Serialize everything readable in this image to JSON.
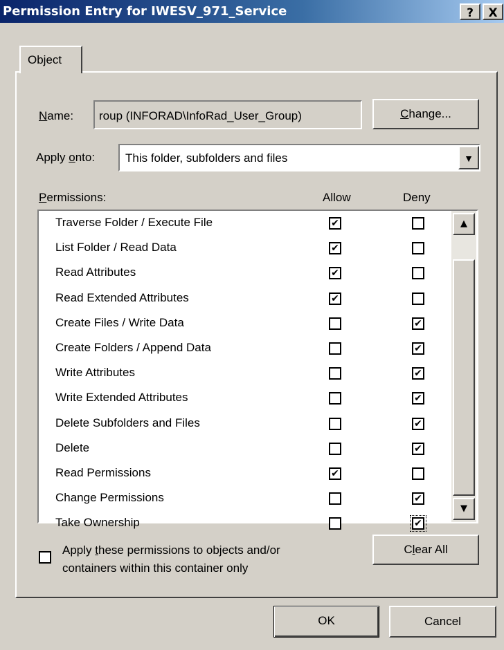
{
  "window": {
    "title": "Permission Entry for IWESV_971_Service",
    "help_btn": "?",
    "close_btn": "X"
  },
  "tab": {
    "label": "Object"
  },
  "name": {
    "label_u": "N",
    "label_rest": "ame:",
    "value": "roup (INFORAD\\InfoRad_User_Group)",
    "change_u": "C",
    "change_rest": "hange..."
  },
  "apply_onto": {
    "label_pre": "Apply ",
    "label_u": "o",
    "label_rest": "nto:",
    "value": "This folder, subfolders and files"
  },
  "permissions": {
    "label_u": "P",
    "label_rest": "ermissions:",
    "allow_header": "Allow",
    "deny_header": "Deny",
    "rows": [
      {
        "name": "Traverse Folder / Execute File",
        "allow": true,
        "deny": false
      },
      {
        "name": "List Folder / Read Data",
        "allow": true,
        "deny": false
      },
      {
        "name": "Read Attributes",
        "allow": true,
        "deny": false
      },
      {
        "name": "Read Extended Attributes",
        "allow": true,
        "deny": false
      },
      {
        "name": "Create Files / Write Data",
        "allow": false,
        "deny": true
      },
      {
        "name": "Create Folders / Append Data",
        "allow": false,
        "deny": true
      },
      {
        "name": "Write Attributes",
        "allow": false,
        "deny": true
      },
      {
        "name": "Write Extended Attributes",
        "allow": false,
        "deny": true
      },
      {
        "name": "Delete Subfolders and Files",
        "allow": false,
        "deny": true
      },
      {
        "name": "Delete",
        "allow": false,
        "deny": true
      },
      {
        "name": "Read Permissions",
        "allow": true,
        "deny": false
      },
      {
        "name": "Change Permissions",
        "allow": false,
        "deny": true
      },
      {
        "name": "Take Ownership",
        "allow": false,
        "deny": true
      }
    ]
  },
  "apply_only": {
    "checked": false,
    "line1_pre": "Apply ",
    "line1_u": "t",
    "line1_rest": "hese permissions to objects and/or",
    "line2": "containers within this container only"
  },
  "clear_all": {
    "pre": "C",
    "u": "l",
    "rest": "ear All"
  },
  "ok_label": "OK",
  "cancel_label": "Cancel",
  "icons": {
    "check": "✔",
    "dropdown": "▼",
    "scroll_up": "▲",
    "scroll_down": "▼"
  }
}
